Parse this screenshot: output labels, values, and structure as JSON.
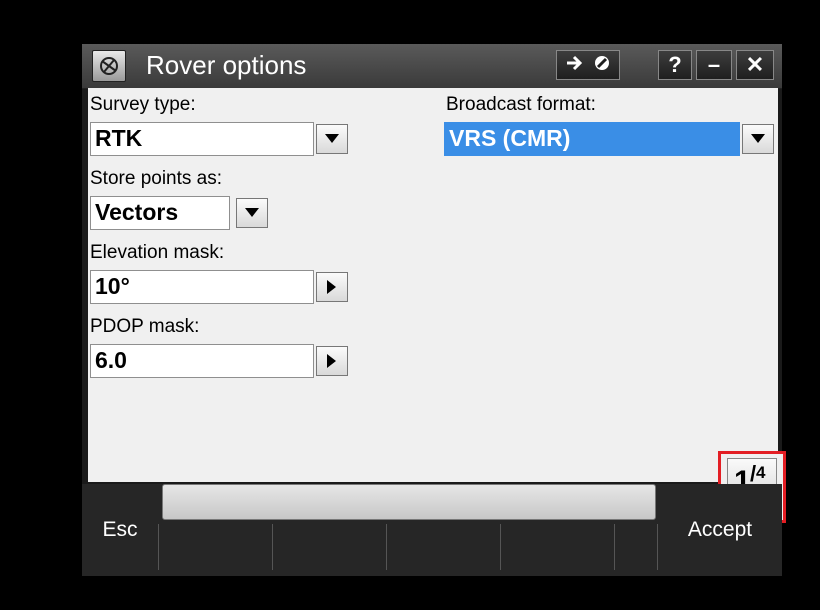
{
  "window": {
    "title": "Rover options"
  },
  "titlebar_buttons": {
    "go_icon": "arrow-right-icon",
    "slash_icon": "block-icon",
    "help": "?",
    "minimize": "–",
    "close": "✕"
  },
  "form": {
    "survey_type": {
      "label": "Survey type:",
      "value": "RTK"
    },
    "broadcast_format": {
      "label": "Broadcast format:",
      "value": "VRS (CMR)"
    },
    "store_points_as": {
      "label": "Store points as:",
      "value": "Vectors"
    },
    "elevation_mask": {
      "label": "Elevation mask:",
      "value": "10°"
    },
    "pdop_mask": {
      "label": "PDOP mask:",
      "value": "6.0"
    }
  },
  "pager": {
    "current": "1",
    "total": "4"
  },
  "softkeys": {
    "esc": "Esc",
    "accept": "Accept"
  },
  "colors": {
    "highlight": "#3a8ee6",
    "callout": "#e31e24"
  }
}
